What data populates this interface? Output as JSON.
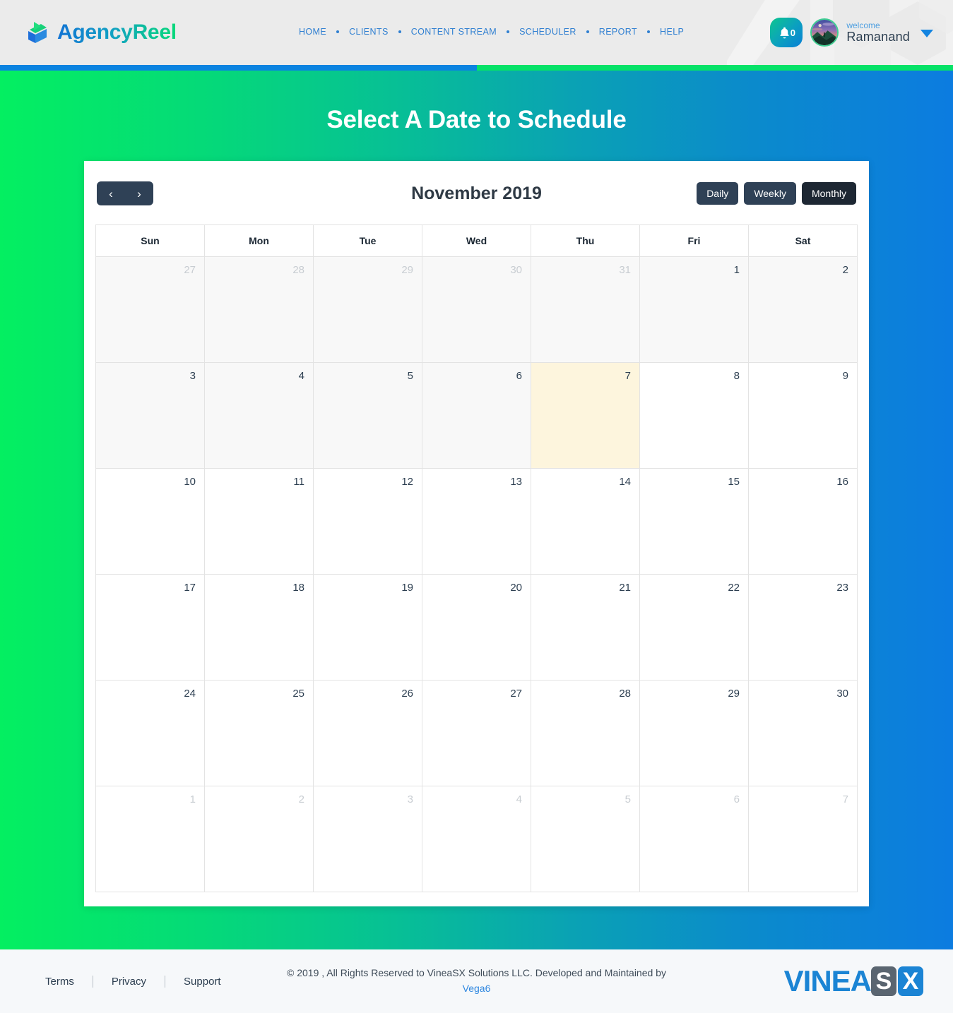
{
  "header": {
    "brand_name": "AgencyReel",
    "brand_logo_icon": "play-reel-logo-icon",
    "nav": [
      {
        "label": "HOME"
      },
      {
        "label": "CLIENTS"
      },
      {
        "label": "CONTENT STREAM"
      },
      {
        "label": "SCHEDULER"
      },
      {
        "label": "REPORT"
      },
      {
        "label": "HELP"
      }
    ],
    "notification": {
      "icon": "bell-icon",
      "count": "0"
    },
    "user": {
      "welcome_label": "welcome",
      "name": "Ramanand",
      "avatar_icon": "user-avatar",
      "caret_icon": "chevron-down-icon"
    }
  },
  "page": {
    "title": "Select A Date to Schedule"
  },
  "calendar": {
    "prev_label": "‹",
    "next_label": "›",
    "title": "November 2019",
    "views": [
      {
        "label": "Daily",
        "active": false
      },
      {
        "label": "Weekly",
        "active": false
      },
      {
        "label": "Monthly",
        "active": true
      }
    ],
    "weekdays": [
      "Sun",
      "Mon",
      "Tue",
      "Wed",
      "Thu",
      "Fri",
      "Sat"
    ],
    "weeks": [
      [
        {
          "day": "27",
          "state": "other past"
        },
        {
          "day": "28",
          "state": "other past"
        },
        {
          "day": "29",
          "state": "other past"
        },
        {
          "day": "30",
          "state": "other past"
        },
        {
          "day": "31",
          "state": "other past"
        },
        {
          "day": "1",
          "state": "past"
        },
        {
          "day": "2",
          "state": "past"
        }
      ],
      [
        {
          "day": "3",
          "state": "past"
        },
        {
          "day": "4",
          "state": "past"
        },
        {
          "day": "5",
          "state": "past"
        },
        {
          "day": "6",
          "state": "past"
        },
        {
          "day": "7",
          "state": "today"
        },
        {
          "day": "8",
          "state": ""
        },
        {
          "day": "9",
          "state": ""
        }
      ],
      [
        {
          "day": "10",
          "state": ""
        },
        {
          "day": "11",
          "state": ""
        },
        {
          "day": "12",
          "state": ""
        },
        {
          "day": "13",
          "state": ""
        },
        {
          "day": "14",
          "state": ""
        },
        {
          "day": "15",
          "state": ""
        },
        {
          "day": "16",
          "state": ""
        }
      ],
      [
        {
          "day": "17",
          "state": ""
        },
        {
          "day": "18",
          "state": ""
        },
        {
          "day": "19",
          "state": ""
        },
        {
          "day": "20",
          "state": ""
        },
        {
          "day": "21",
          "state": ""
        },
        {
          "day": "22",
          "state": ""
        },
        {
          "day": "23",
          "state": ""
        }
      ],
      [
        {
          "day": "24",
          "state": ""
        },
        {
          "day": "25",
          "state": ""
        },
        {
          "day": "26",
          "state": ""
        },
        {
          "day": "27",
          "state": ""
        },
        {
          "day": "28",
          "state": ""
        },
        {
          "day": "29",
          "state": ""
        },
        {
          "day": "30",
          "state": ""
        }
      ],
      [
        {
          "day": "1",
          "state": "other"
        },
        {
          "day": "2",
          "state": "other"
        },
        {
          "day": "3",
          "state": "other"
        },
        {
          "day": "4",
          "state": "other"
        },
        {
          "day": "5",
          "state": "other"
        },
        {
          "day": "6",
          "state": "other"
        },
        {
          "day": "7",
          "state": "other"
        }
      ]
    ]
  },
  "footer": {
    "links": [
      {
        "label": "Terms"
      },
      {
        "label": "Privacy"
      },
      {
        "label": "Support"
      }
    ],
    "copyright": "© 2019 , All Rights Reserved to VineaSX Solutions LLC. Developed and Maintained by",
    "developer_link": "Vega6",
    "logo": {
      "word": "VINEA",
      "box_s": "S",
      "box_x": "X"
    }
  },
  "colors": {
    "accent_blue": "#0b83e0",
    "accent_green": "#06e268",
    "dark_button": "#2f4156",
    "dark_button_active": "#1d2733",
    "today_highlight": "#fdf5dd",
    "nav_link": "#2f7fd1"
  }
}
